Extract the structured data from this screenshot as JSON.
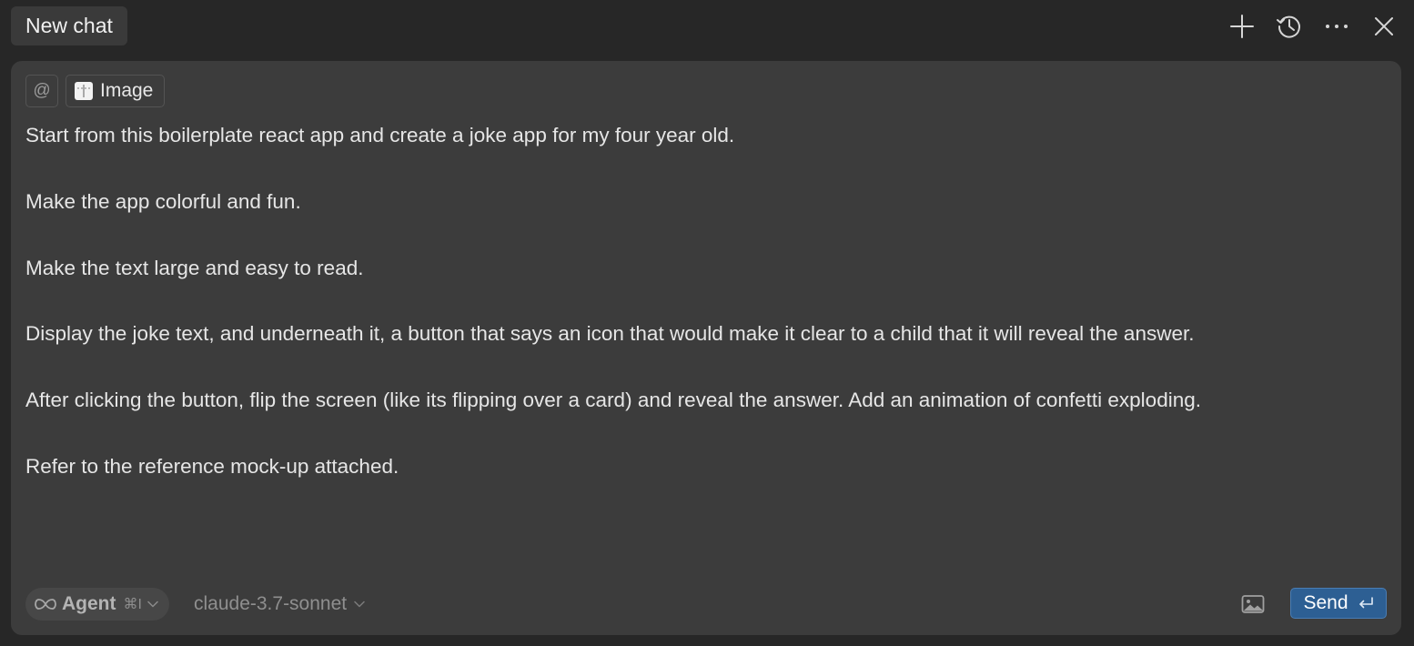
{
  "header": {
    "tab_title": "New chat",
    "icons": [
      "plus-icon",
      "history-icon",
      "more-icon",
      "close-icon"
    ]
  },
  "composer": {
    "context": {
      "mention_symbol": "@",
      "attachment_label": "Image"
    },
    "message": [
      "Start from this boilerplate react app and create a joke app for my four year old.",
      "Make the app colorful and fun.",
      "Make the text large and easy to read.",
      "Display the joke text, and underneath it, a button that says an icon that would make it clear to a child that it will reveal the answer.",
      "After clicking the button, flip the screen (like its flipping over a card) and reveal the answer. Add an animation of confetti exploding.",
      "Refer to the reference mock-up attached."
    ],
    "footer": {
      "mode_label": "Agent",
      "mode_shortcut": "⌘I",
      "model": "claude-3.7-sonnet",
      "send_label": "Send"
    }
  },
  "colors": {
    "background": "#272727",
    "composer": "#3c3c3c",
    "accent": "#2d5f93"
  }
}
